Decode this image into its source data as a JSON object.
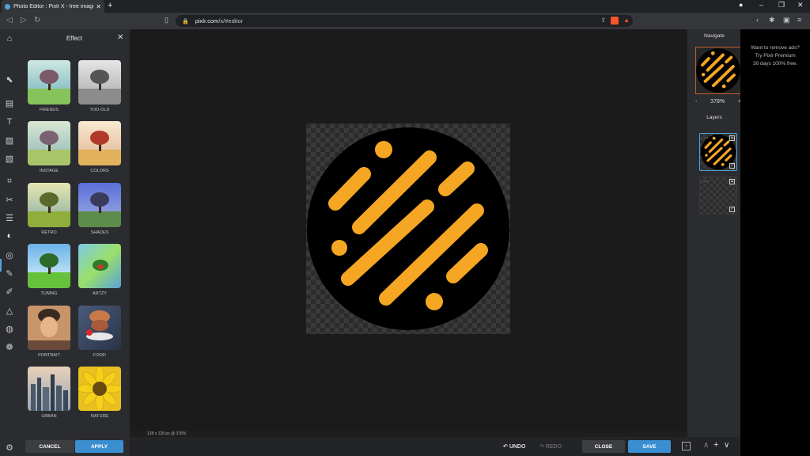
{
  "browser": {
    "tab_title": "Photo Editor : Pixlr X - free image...",
    "tab_close": "✕",
    "new_tab": "+",
    "url_domain": "pixlr.com",
    "url_path": "/x/#editor"
  },
  "effect_panel": {
    "title": "Effect",
    "close": "✕",
    "effects": [
      {
        "label": "FRIENDS"
      },
      {
        "label": "TOO-OLD"
      },
      {
        "label": "INSTAGE"
      },
      {
        "label": "COLORS"
      },
      {
        "label": "RETRO"
      },
      {
        "label": "SHADES"
      },
      {
        "label": "TUNING"
      },
      {
        "label": "ARTZY"
      },
      {
        "label": "PORTRAIT"
      },
      {
        "label": "FOOD"
      },
      {
        "label": "URBAN"
      },
      {
        "label": "NATURE"
      }
    ],
    "cancel_label": "CANCEL",
    "apply_label": "APPLY"
  },
  "canvas": {
    "status": "128 x 128 px @ 378%"
  },
  "bottom_bar": {
    "undo_label": "UNDO",
    "redo_label": "REDO",
    "close_label": "CLOSE",
    "save_label": "SAVE"
  },
  "right_panel": {
    "navigate_title": "Navigate",
    "zoom_minus": "-",
    "zoom_value": "378%",
    "zoom_plus": "+",
    "layers_title": "Layers"
  },
  "ad": {
    "line1": "Want to remove ads?",
    "line2": "Try Pixlr Premium",
    "line3": "30 days 100% free."
  },
  "colors": {
    "accent": "#4fa3e0",
    "logo_orange": "#f5a623",
    "logo_black": "#000000"
  }
}
